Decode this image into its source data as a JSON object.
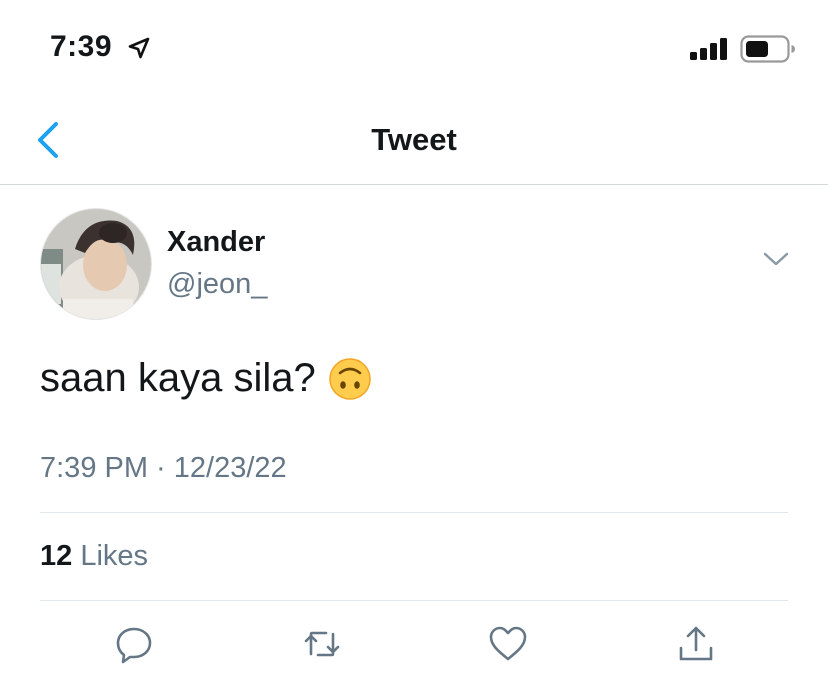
{
  "status_bar": {
    "time": "7:39",
    "location_icon": "location-arrow-icon",
    "signal_icon": "cellular-signal-icon",
    "battery_icon": "battery-icon"
  },
  "nav": {
    "title": "Tweet",
    "back_icon": "chevron-left-icon"
  },
  "tweet": {
    "author": {
      "display_name": "Xander",
      "handle": "@jeon_"
    },
    "text": "saan kaya sila?",
    "emoji": "upside-down-face-emoji",
    "timestamp": "7:39 PM · 12/23/22",
    "likes_count": "12",
    "likes_label": "Likes",
    "actions": [
      "reply-icon",
      "retweet-icon",
      "like-icon",
      "share-icon"
    ]
  },
  "colors": {
    "accent": "#1da1f2",
    "secondary_text": "#657786",
    "divider": "#e1e8ed",
    "icon": "#657786"
  }
}
